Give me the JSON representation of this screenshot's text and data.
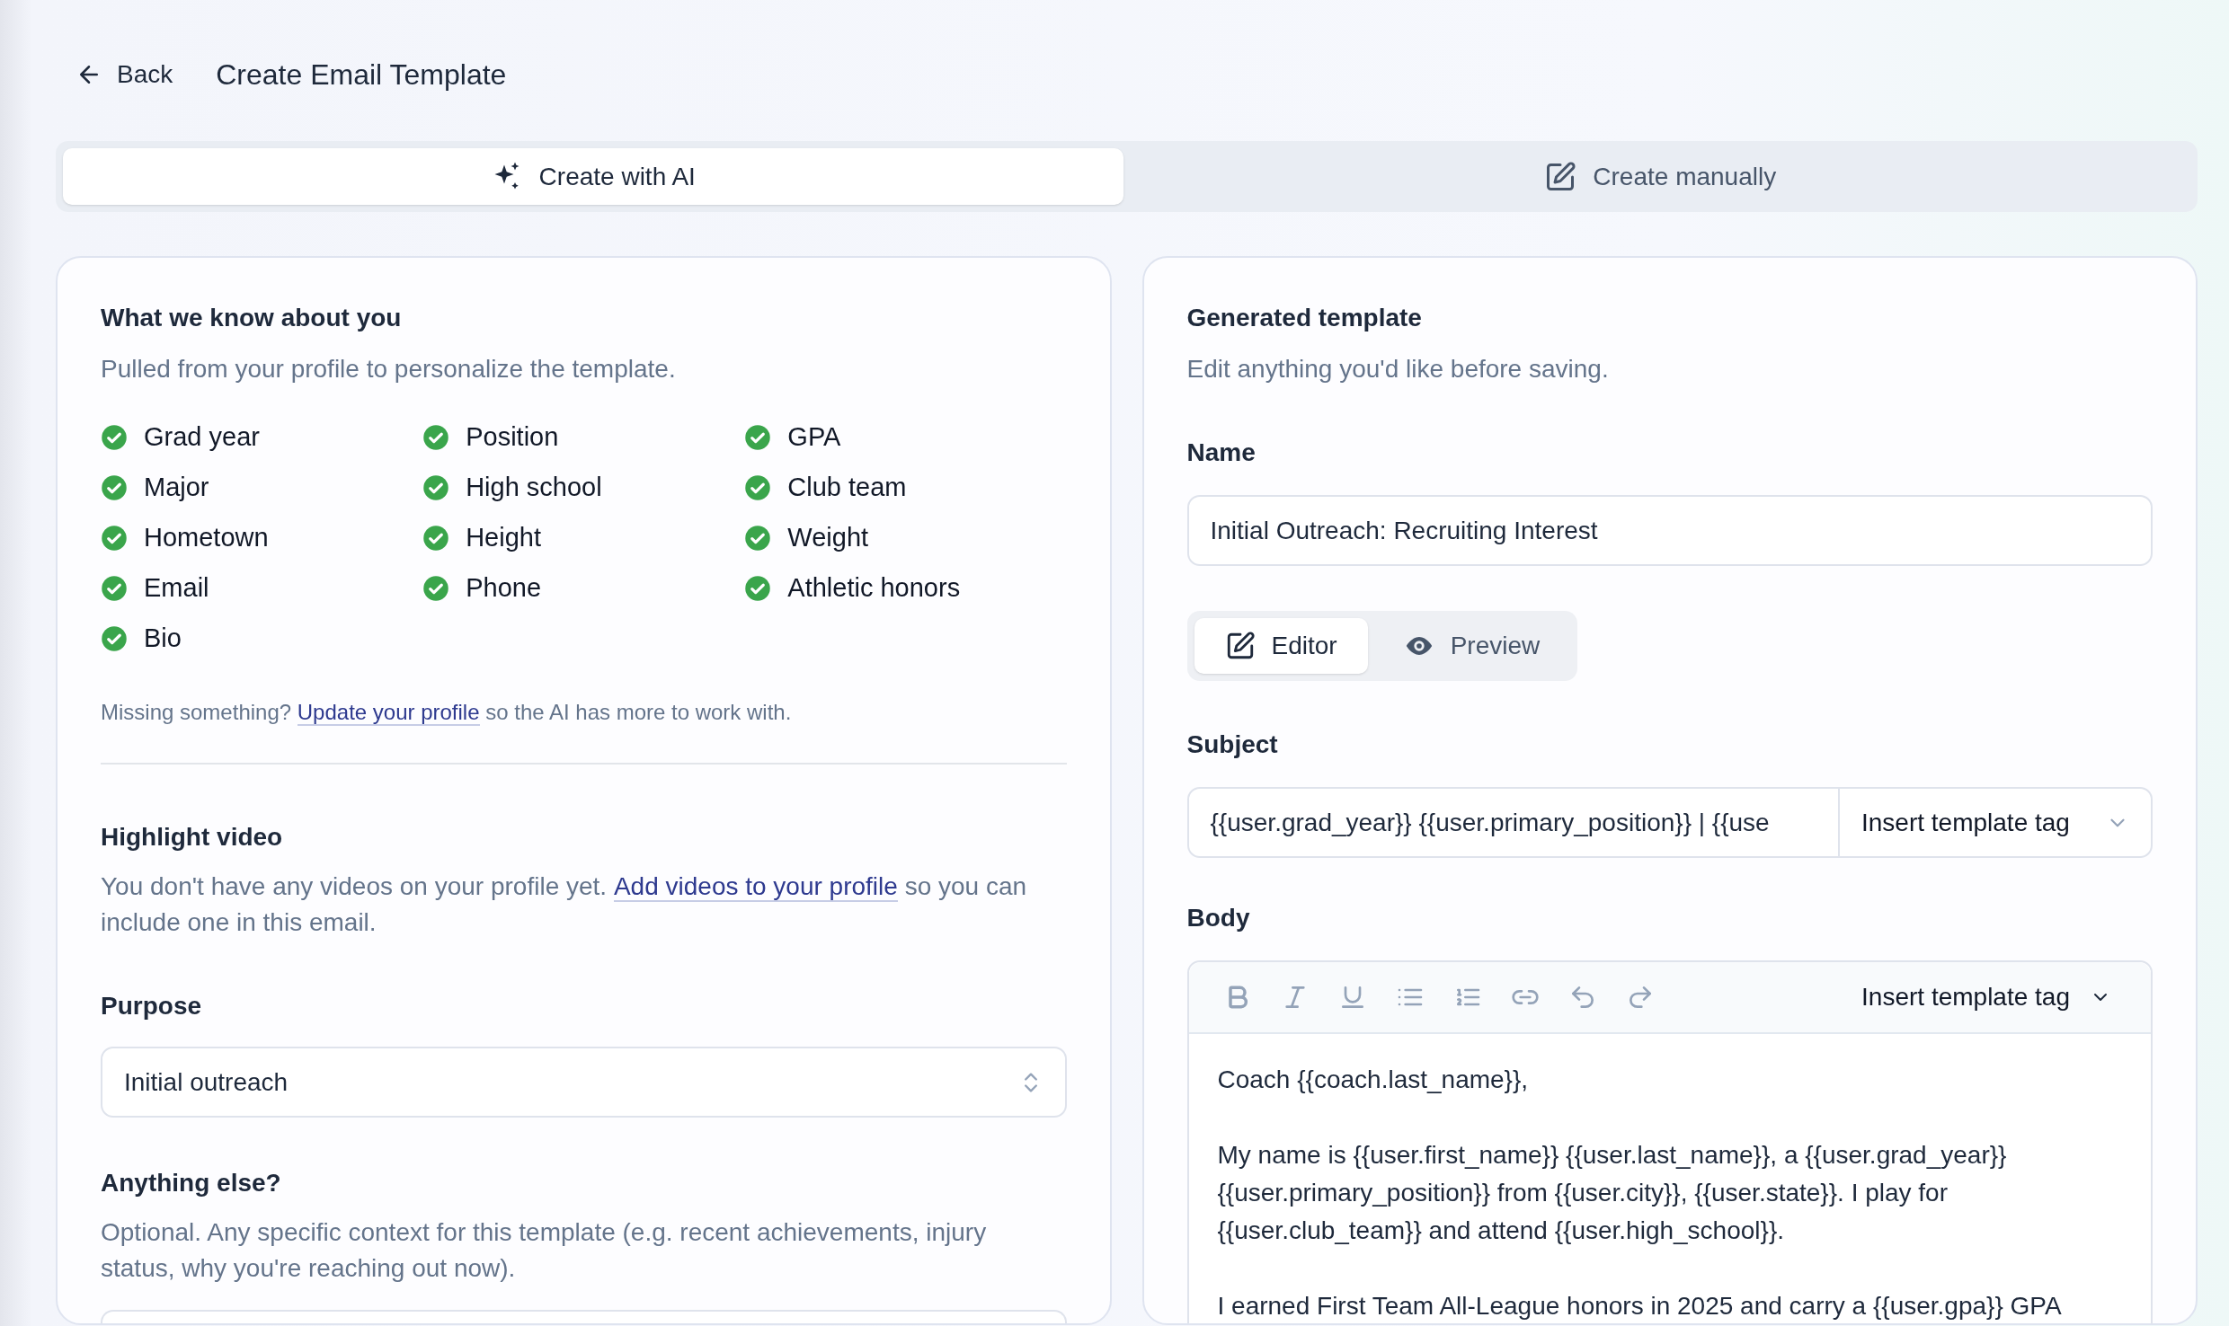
{
  "header": {
    "back_label": "Back",
    "title": "Create Email Template"
  },
  "mode_tabs": [
    {
      "label": "Create with AI",
      "selected": true
    },
    {
      "label": "Create manually",
      "selected": false
    }
  ],
  "profile_card": {
    "title": "What we know about you",
    "subtitle": "Pulled from your profile to personalize the template.",
    "fields": [
      {
        "label": "Grad year",
        "checked": true
      },
      {
        "label": "Position",
        "checked": true
      },
      {
        "label": "GPA",
        "checked": true
      },
      {
        "label": "Major",
        "checked": true
      },
      {
        "label": "High school",
        "checked": true
      },
      {
        "label": "Club team",
        "checked": true
      },
      {
        "label": "Hometown",
        "checked": true
      },
      {
        "label": "Height",
        "checked": true
      },
      {
        "label": "Weight",
        "checked": true
      },
      {
        "label": "Email",
        "checked": true
      },
      {
        "label": "Phone",
        "checked": true
      },
      {
        "label": "Athletic honors",
        "checked": true
      },
      {
        "label": "Bio",
        "checked": true
      }
    ],
    "missing_note": {
      "before": "Missing something?",
      "link": "Update your profile",
      "after": "so the AI has more to work with."
    }
  },
  "highlight_video": {
    "title": "Highlight video",
    "before": "You don't have any videos on your profile yet.",
    "link": "Add videos to your profile",
    "after": "so you can include one in this email."
  },
  "purpose": {
    "label": "Purpose",
    "value": "Initial outreach"
  },
  "anything_else": {
    "label": "Anything else?",
    "help": "Optional. Any specific context for this template (e.g. recent achievements, injury status, why you're reaching out now)."
  },
  "template_card": {
    "title": "Generated template",
    "subtitle": "Edit anything you'd like before saving.",
    "name": {
      "label": "Name",
      "value": "Initial Outreach: Recruiting Interest"
    },
    "view_tabs": [
      {
        "label": "Editor",
        "selected": true
      },
      {
        "label": "Preview",
        "selected": false
      }
    ],
    "subject": {
      "label": "Subject",
      "value": "{{user.grad_year}} {{user.primary_position}} | {{use",
      "tag_button": "Insert template tag"
    },
    "body": {
      "label": "Body",
      "tag_button": "Insert template tag",
      "paragraphs": [
        "Coach {{coach.last_name}},",
        "My name is {{user.first_name}} {{user.last_name}}, a {{user.grad_year}} {{user.primary_position}} from {{user.city}}, {{user.state}}. I play for {{user.club_team}} and attend {{user.high_school}}.",
        "I earned First Team All-League honors in 2025 and carry a {{user.gpa}} GPA"
      ]
    }
  }
}
